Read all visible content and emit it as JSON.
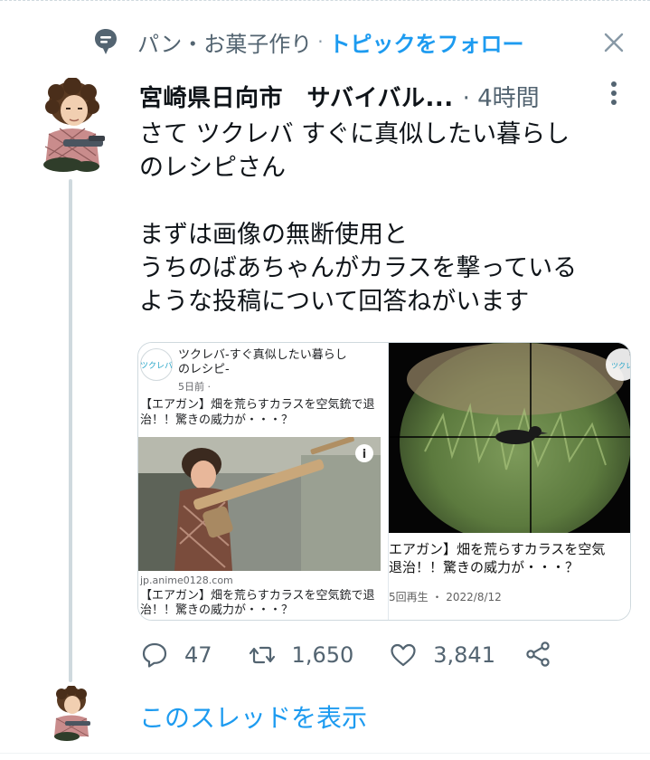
{
  "topic": {
    "name": "パン・お菓子作り",
    "separator": "·",
    "follow_label": "トピックをフォロー",
    "icon": "topic-bubble-icon"
  },
  "tweet": {
    "author": "宮崎県日向市　サバイバル...",
    "time": "· 4時間",
    "text_lines": [
      "さて ツクレバ すぐに真似したい暮らし",
      "のレシピさん",
      "",
      "まずは画像の無断使用と",
      "うちのばあちゃんがカラスを撃っている",
      "ような投稿について回答ねがいます"
    ]
  },
  "media_left": {
    "page_name_line1": "ツクレバ-すぐ真似したい暮らし",
    "page_name_line2": "のレシピ-",
    "posted": "5日前 · ",
    "caption_line1": "【エアガン】畑を荒らすカラスを空気銃で退",
    "caption_line2": "治！！驚きの威力が・・・？",
    "domain": "jp.anime0128.com",
    "link_title_line1": "【エアガン】畑を荒らすカラスを空気銃で退",
    "link_title_line2": "治！！驚きの威力が・・・？",
    "logo_text": "ツクレバ",
    "info_badge": "i"
  },
  "media_right": {
    "title_line1": "エアガン】畑を荒らすカラスを空気",
    "title_line2": "退治！！驚きの威力が・・・？",
    "meta": "5回再生 ・ 2022/8/12",
    "logo_text": "ツクレ"
  },
  "actions": {
    "reply_count": "47",
    "retweet_count": "1,650",
    "like_count": "3,841"
  },
  "show_thread_label": "このスレッドを表示",
  "colors": {
    "accent": "#1d9bf0",
    "secondary_text": "#536471",
    "primary_text": "#0f1419",
    "thread_line": "#cfd9de"
  }
}
